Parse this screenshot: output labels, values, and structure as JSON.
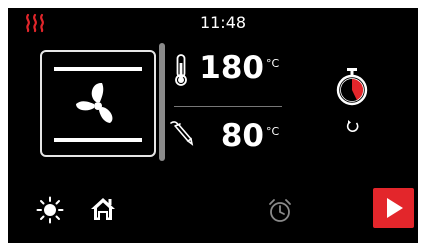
{
  "status_bar": {
    "time": "11:48",
    "heating_icon": "heating-icon"
  },
  "oven": {
    "mode_icon": "fan-icon"
  },
  "oven_temperature": {
    "value": "180",
    "unit": "°C",
    "icon": "thermometer-icon"
  },
  "core_probe": {
    "value": "80",
    "unit": "°C",
    "icon": "probe-icon"
  },
  "timer": {
    "icon": "stopwatch-icon",
    "reset_icon": "reset-icon"
  },
  "bottom_bar": {
    "light_icon": "light-icon",
    "home_icon": "home-icon",
    "alarm_icon": "alarm-clock-icon",
    "start_icon": "play-icon"
  },
  "colors": {
    "background": "#000000",
    "accent_red": "#e3262b",
    "foreground": "#ffffff",
    "muted": "#8a8a8a"
  }
}
